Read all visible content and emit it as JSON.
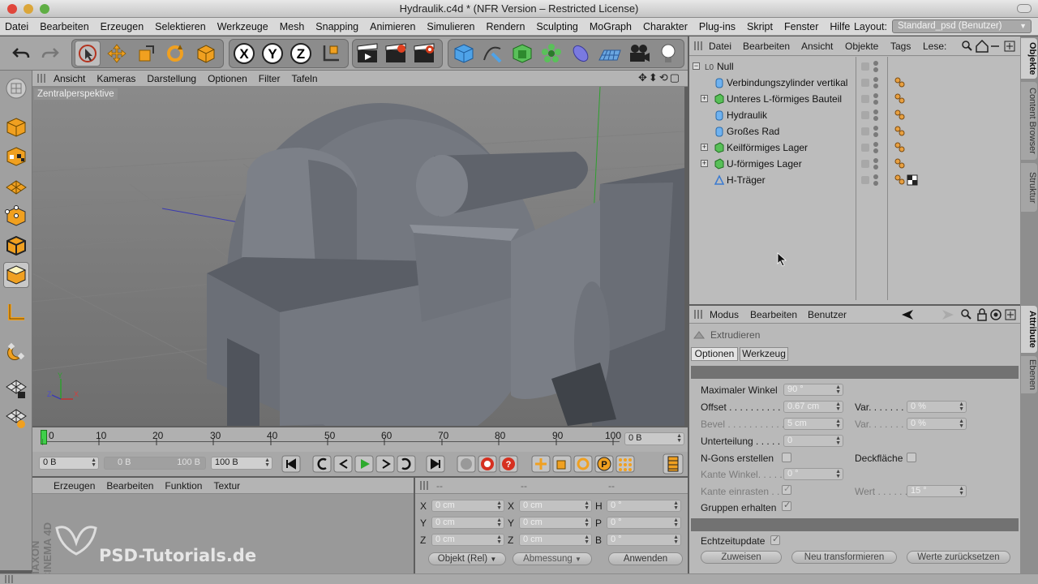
{
  "window": {
    "title": "Hydraulik.c4d * (NFR Version – Restricted License)"
  },
  "menubar": {
    "items": [
      "Datei",
      "Bearbeiten",
      "Erzeugen",
      "Selektieren",
      "Werkzeuge",
      "Mesh",
      "Snapping",
      "Animieren",
      "Simulieren",
      "Rendern",
      "Sculpting",
      "MoGraph",
      "Charakter",
      "Plug-ins",
      "Skript",
      "Fenster",
      "Hilfe"
    ],
    "layout_label": "Layout:",
    "layout_value": "Standard_psd (Benutzer)"
  },
  "viewport": {
    "menu": [
      "Ansicht",
      "Kameras",
      "Darstellung",
      "Optionen",
      "Filter",
      "Tafeln"
    ],
    "camera_label": "Zentralperspektive",
    "axis": {
      "y": "Y",
      "z": "Z",
      "x": "X"
    }
  },
  "timeline": {
    "ticks": [
      "0",
      "10",
      "20",
      "30",
      "40",
      "50",
      "60",
      "70",
      "80",
      "90",
      "100"
    ],
    "current_frame": "0 B"
  },
  "transport": {
    "start": "0 B",
    "range_start": "0 B",
    "range_end": "100 B",
    "end": "100 B"
  },
  "material_manager": {
    "menu": [
      "Erzeugen",
      "Bearbeiten",
      "Funktion",
      "Textur"
    ],
    "watermark": "PSD-Tutorials.de",
    "brand": "MAXON CINEMA 4D"
  },
  "coordinate_manager": {
    "headers": [
      "--",
      "--",
      "--"
    ],
    "rows": [
      {
        "a": "X",
        "av": "0 cm",
        "b": "X",
        "bv": "0 cm",
        "c": "H",
        "cv": "0 °"
      },
      {
        "a": "Y",
        "av": "0 cm",
        "b": "Y",
        "bv": "0 cm",
        "c": "P",
        "cv": "0 °"
      },
      {
        "a": "Z",
        "av": "0 cm",
        "b": "Z",
        "bv": "0 cm",
        "c": "B",
        "cv": "0 °"
      }
    ],
    "mode_select": "Objekt (Rel)",
    "size_select": "Abmessung",
    "apply_button": "Anwenden"
  },
  "object_manager": {
    "menu": [
      "Datei",
      "Bearbeiten",
      "Ansicht",
      "Objekte",
      "Tags",
      "Lese:"
    ],
    "objects": [
      {
        "name": "Null",
        "indent": 0,
        "expand": "minus",
        "icon": "null",
        "tags": 0
      },
      {
        "name": "Verbindungszylinder vertikal",
        "indent": 1,
        "expand": "",
        "icon": "cylinder",
        "tags": 1
      },
      {
        "name": "Unteres L-förmiges Bauteil",
        "indent": 1,
        "expand": "plus",
        "icon": "extrude",
        "tags": 1
      },
      {
        "name": "Hydraulik",
        "indent": 1,
        "expand": "",
        "icon": "cylinder",
        "tags": 1
      },
      {
        "name": "Großes Rad",
        "indent": 1,
        "expand": "",
        "icon": "cylinder",
        "tags": 1
      },
      {
        "name": "Keilförmiges Lager",
        "indent": 1,
        "expand": "plus",
        "icon": "extrude",
        "tags": 1
      },
      {
        "name": "U-förmiges Lager",
        "indent": 1,
        "expand": "plus",
        "icon": "extrude",
        "tags": 1
      },
      {
        "name": "H-Träger",
        "indent": 1,
        "expand": "",
        "icon": "spline",
        "tags": 2
      }
    ]
  },
  "attribute_manager": {
    "menu": [
      "Modus",
      "Bearbeiten",
      "Benutzer"
    ],
    "tool_name": "Extrudieren",
    "tabs": [
      "Optionen",
      "Werkzeug"
    ],
    "fields": {
      "max_angle_label": "Maximaler Winkel",
      "max_angle_value": "90 °",
      "offset_label": "Offset . . . . . . . . . . .",
      "offset_value": "0.67 cm",
      "var1_label": "Var. . . . . . .",
      "var1_value": "0 %",
      "bevel_label": "Bevel . . . . . . . . . . . .",
      "bevel_value": "5 cm",
      "var2_label": "Var. . . . . . .",
      "var2_value": "0 %",
      "subdiv_label": "Unterteilung . . . . . .",
      "subdiv_value": "0",
      "ngons_label": "N-Gons erstellen",
      "cap_label": "Deckfläche",
      "edge_angle_label": "Kante Winkel. . . . .",
      "edge_angle_value": "0 °",
      "edge_snap_label": "Kante einrasten . .",
      "value_label": "Wert . . . . . .",
      "value_value": "15 °",
      "keep_groups_label": "Gruppen erhalten",
      "realtime_label": "Echtzeitupdate"
    },
    "buttons": [
      "Zuweisen",
      "Neu transformieren",
      "Werte zurücksetzen"
    ]
  },
  "side_tabs": [
    "Objekte",
    "Content Browser",
    "Struktur",
    "Attribute",
    "Ebenen"
  ],
  "colors": {
    "accent_blue": "#3f7fd0",
    "toolbar_bg": "#a6a6a6",
    "panel_bg": "#b9b9b9"
  }
}
